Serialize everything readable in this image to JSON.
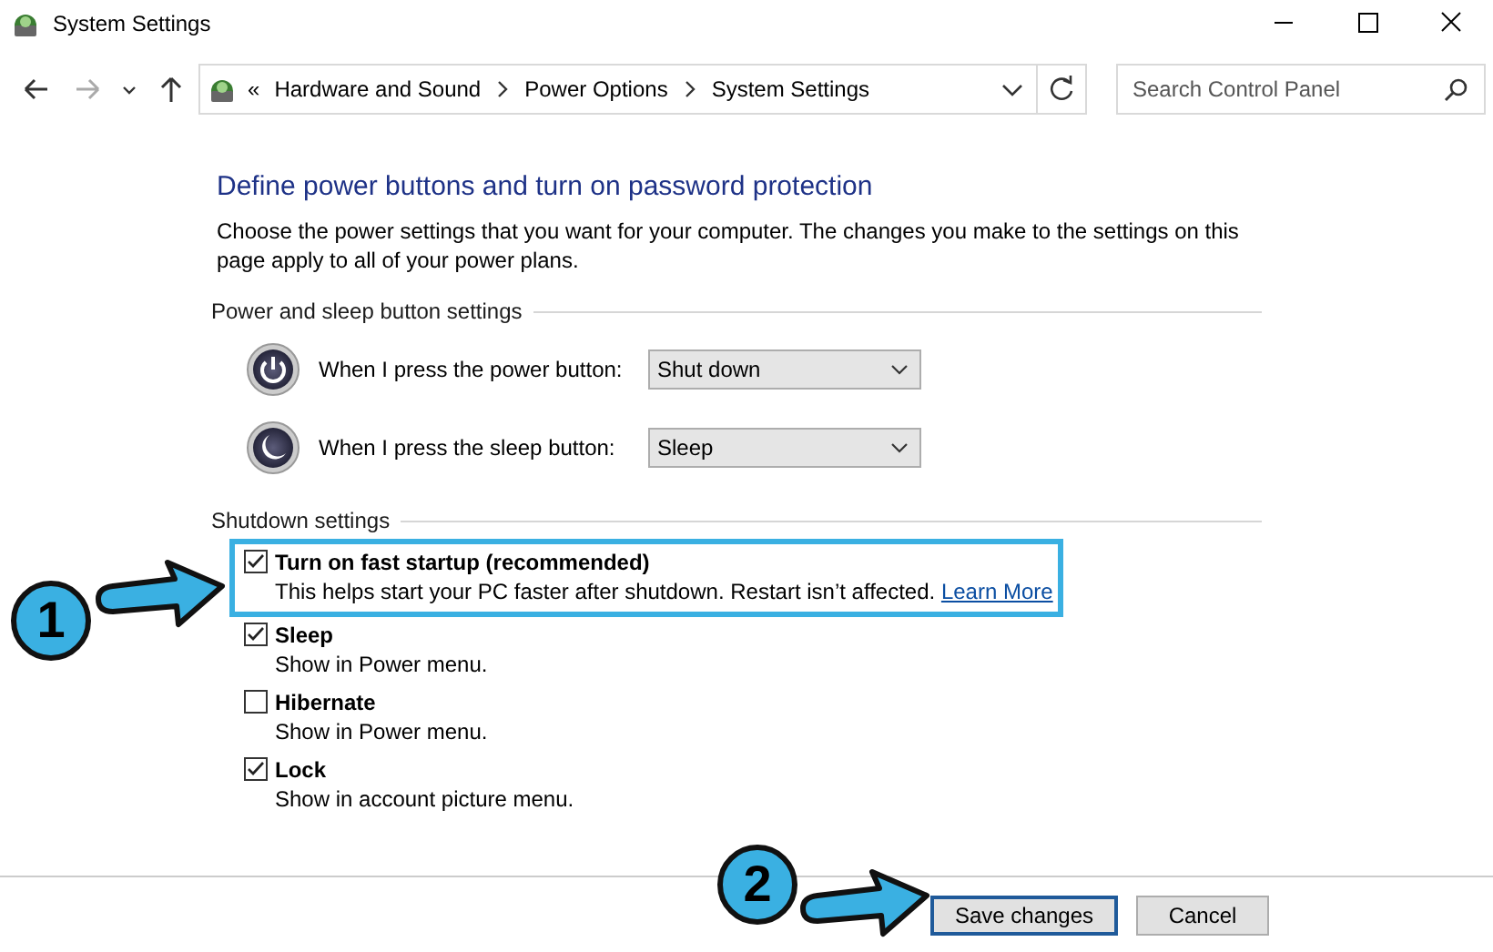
{
  "window": {
    "title": "System Settings"
  },
  "address_bar": {
    "overflow": "«",
    "crumbs": [
      "Hardware and Sound",
      "Power Options",
      "System Settings"
    ]
  },
  "search": {
    "placeholder": "Search Control Panel"
  },
  "heading": "Define power buttons and turn on password protection",
  "intro": "Choose the power settings that you want for your computer. The changes you make to the settings on this page apply to all of your power plans.",
  "button_section": {
    "title": "Power and sleep button settings",
    "rows": [
      {
        "kind": "power",
        "label": "When I press the power button:",
        "value": "Shut down"
      },
      {
        "kind": "sleep",
        "label": "When I press the sleep button:",
        "value": "Sleep"
      }
    ]
  },
  "shutdown_section": {
    "title": "Shutdown settings",
    "items": [
      {
        "label": "Turn on fast startup (recommended)",
        "description": "This helps start your PC faster after shutdown. Restart isn’t affected.",
        "link": "Learn More",
        "checked": true,
        "highlighted": true
      },
      {
        "label": "Sleep",
        "description": "Show in Power menu.",
        "checked": true,
        "highlighted": false
      },
      {
        "label": "Hibernate",
        "description": "Show in Power menu.",
        "checked": false,
        "highlighted": false
      },
      {
        "label": "Lock",
        "description": "Show in account picture menu.",
        "checked": true,
        "highlighted": false
      }
    ]
  },
  "buttons": [
    {
      "label": "Save changes",
      "selected": true
    },
    {
      "label": "Cancel",
      "selected": false
    }
  ],
  "callouts": [
    {
      "label": "1"
    },
    {
      "label": "2"
    }
  ]
}
